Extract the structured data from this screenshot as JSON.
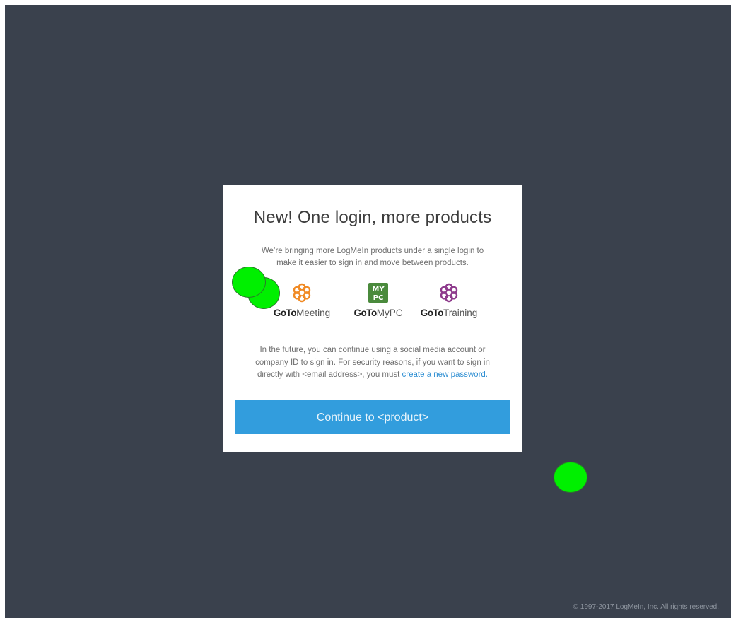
{
  "modal": {
    "title": "New! One login, more products",
    "intro": "We’re bringing more LogMeIn products under a single login to make it easier to sign in and move between products.",
    "products": [
      {
        "goto": "GoTo",
        "rest": "Meeting",
        "icon": "gotomeeting-flower-icon",
        "color": "#f08a24"
      },
      {
        "goto": "GoTo",
        "rest": "MyPC",
        "icon": "gotomypc-icon",
        "color": "#4a8a3c"
      },
      {
        "goto": "GoTo",
        "rest": "Training",
        "icon": "gototraining-flower-icon",
        "color": "#8e3a8c"
      }
    ],
    "note_text": "In the future, you can continue using a social media account or company ID to sign in. For security reasons, if you want to sign in directly with <email address>, you must ",
    "note_link": "create a new password.",
    "continue_label": "Continue to <product>",
    "mypc_badge_top": "MY",
    "mypc_badge_bottom": "PC"
  },
  "footer": {
    "copyright": "© 1997-2017 LogMeIn, Inc. All rights reserved."
  },
  "colors": {
    "background": "#3a414d",
    "button": "#329ddd",
    "link": "#2f8fd3",
    "marker": "#00f000"
  }
}
